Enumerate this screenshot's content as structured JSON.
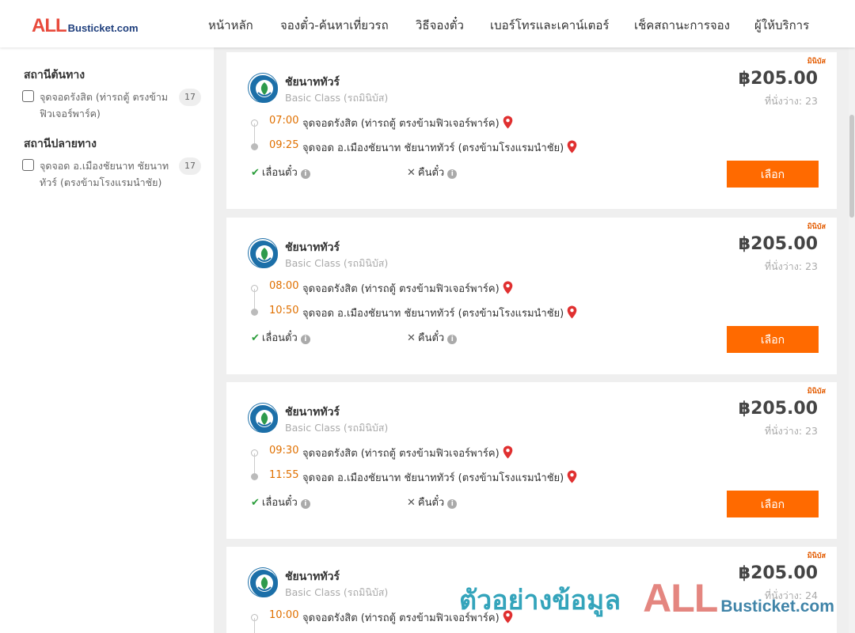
{
  "header": {
    "logo_all": "ALL",
    "logo_busticket": "Busticket.com",
    "nav": [
      {
        "label": "หน้าหลัก"
      },
      {
        "label": "จองตั๋ว-ค้นหาเที่ยวรถ"
      },
      {
        "label": "วิธีจองตั๋ว"
      },
      {
        "label": "เบอร์โทรและเคาน์เตอร์"
      },
      {
        "label": "เช็คสถานะการจอง"
      },
      {
        "label": "ผู้ให้บริการ"
      }
    ]
  },
  "sidebar": {
    "origin_title": "สถานีต้นทาง",
    "origin_option": "จุดจอดรังสิต (ท่ารถตู้ ตรงข้ามฟิวเจอร์พาร์ค)",
    "origin_count": "17",
    "dest_title": "สถานีปลายทาง",
    "dest_option": "จุดจอด อ.เมืองชัยนาท ชัยนาททัวร์ (ตรงข้ามโรงแรมนำชัย)",
    "dest_count": "17"
  },
  "trips": [
    {
      "tag": "มินิบัส",
      "operator": "ชัยนาททัวร์",
      "class": "Basic Class (รถมินิบัส)",
      "price": "฿205.00",
      "seats": "ที่นั่งว่าง: 23",
      "depart_time": "07:00",
      "depart_stop": "จุดจอดรังสิต (ท่ารถตู้ ตรงข้ามฟิวเจอร์พาร์ค)",
      "arrive_time": "09:25",
      "arrive_stop": "จุดจอด อ.เมืองชัยนาท ชัยนาททัวร์ (ตรงข้ามโรงแรมนำชัย)",
      "postpone": "เลื่อนตั๋ว",
      "refund": "คืนตั๋ว",
      "button": "เลือก"
    },
    {
      "tag": "มินิบัส",
      "operator": "ชัยนาททัวร์",
      "class": "Basic Class (รถมินิบัส)",
      "price": "฿205.00",
      "seats": "ที่นั่งว่าง: 23",
      "depart_time": "08:00",
      "depart_stop": "จุดจอดรังสิต (ท่ารถตู้ ตรงข้ามฟิวเจอร์พาร์ค)",
      "arrive_time": "10:50",
      "arrive_stop": "จุดจอด อ.เมืองชัยนาท ชัยนาททัวร์ (ตรงข้ามโรงแรมนำชัย)",
      "postpone": "เลื่อนตั๋ว",
      "refund": "คืนตั๋ว",
      "button": "เลือก"
    },
    {
      "tag": "มินิบัส",
      "operator": "ชัยนาททัวร์",
      "class": "Basic Class (รถมินิบัส)",
      "price": "฿205.00",
      "seats": "ที่นั่งว่าง: 23",
      "depart_time": "09:30",
      "depart_stop": "จุดจอดรังสิต (ท่ารถตู้ ตรงข้ามฟิวเจอร์พาร์ค)",
      "arrive_time": "11:55",
      "arrive_stop": "จุดจอด อ.เมืองชัยนาท ชัยนาททัวร์ (ตรงข้ามโรงแรมนำชัย)",
      "postpone": "เลื่อนตั๋ว",
      "refund": "คืนตั๋ว",
      "button": "เลือก"
    },
    {
      "tag": "มินิบัส",
      "operator": "ชัยนาททัวร์",
      "class": "Basic Class (รถมินิบัส)",
      "price": "฿205.00",
      "seats": "ที่นั่งว่าง: 24",
      "depart_time": "10:00",
      "depart_stop": "จุดจอดรังสิต (ท่ารถตู้ ตรงข้ามฟิวเจอร์พาร์ค)"
    }
  ],
  "watermark": {
    "text": "ตัวอย่างข้อมูล",
    "all": "ALL",
    "busticket": "Busticket.com"
  },
  "icons": {
    "pin": "map-pin-icon",
    "check": "check-icon",
    "cross": "cross-icon",
    "info": "info-icon"
  },
  "colors": {
    "accent": "#ff6a00",
    "time": "#e07000",
    "pin": "#e03030",
    "check": "#2a9d3a"
  }
}
